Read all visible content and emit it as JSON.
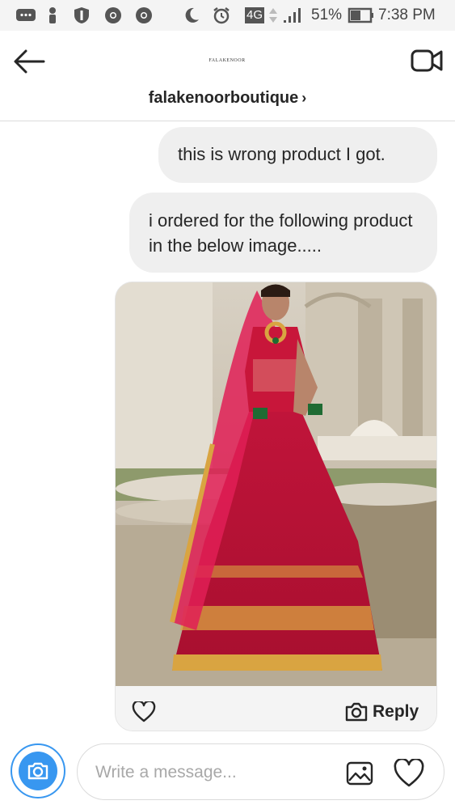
{
  "status_bar": {
    "network": "4G",
    "battery": "51%",
    "time": "7:38 PM"
  },
  "header": {
    "logo_text": "FALAKENOOR",
    "username": "falakenoorboutique",
    "chevron": "›"
  },
  "messages": [
    {
      "text": "this is wrong product I got."
    },
    {
      "text": "i ordered for the following product in the below image....."
    }
  ],
  "photo_message": {
    "description": "bridal-lehenga-photo",
    "reply_label": "Reply"
  },
  "composer": {
    "placeholder": "Write a message..."
  },
  "colors": {
    "bubble": "#efefef",
    "accent": "#3897f0",
    "lehenga": "#c8163a",
    "gold": "#d9a441"
  }
}
